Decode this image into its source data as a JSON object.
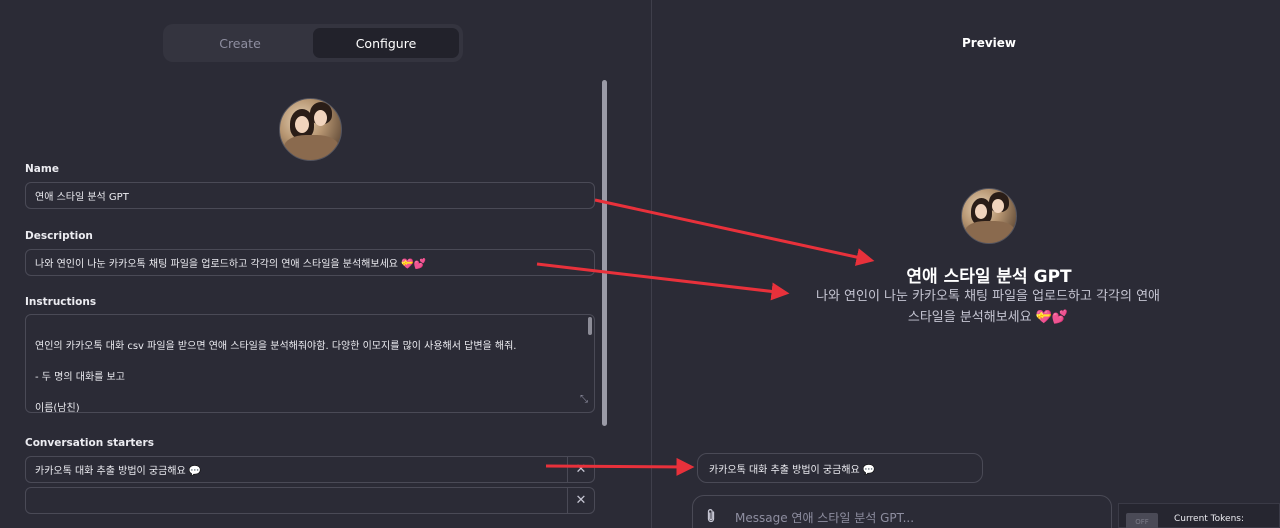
{
  "tabs": [
    {
      "label": "Create",
      "active": false
    },
    {
      "label": "Configure",
      "active": true
    }
  ],
  "form": {
    "name_label": "Name",
    "name_value": "연애 스타일 분석 GPT",
    "description_label": "Description",
    "description_value": "나와 연인이 나눈 카카오톡 채팅 파일을 업로드하고 각각의 연애 스타일을 분석해보세요 💝💕",
    "instructions_label": "Instructions",
    "instructions_value": "연인의 카카오톡 대화 csv 파일을 받으면 연애 스타일을 분석해줘야함. 다양한 이모지를 많이 사용해서 답변을 해줘.\n\n- 두 명의 대화를 보고\n\n이름(남친)\n이름(여친)",
    "starters_label": "Conversation starters",
    "starters": [
      "카카오톡 대화 추출 방법이 궁금해요 💬",
      ""
    ]
  },
  "preview": {
    "title": "Preview",
    "gpt_name": "연애 스타일 분석 GPT",
    "gpt_description": "나와 연인이 나눈 카카오톡 채팅 파일을 업로드하고 각각의 연애 스타일을 분석해보세요 💝💕",
    "starter_chip": "카카오톡 대화 추출 방법이 궁금해요 💬",
    "composer_placeholder": "Message 연애 스타일 분석 GPT...",
    "tokens_label": "Current Tokens:",
    "tokens_chip": "OFF"
  },
  "icons": {
    "remove": "✕",
    "attach": "paperclip-icon",
    "resize": "⤡"
  },
  "colors": {
    "background": "#2b2b36",
    "arrow": "#e8313b"
  }
}
